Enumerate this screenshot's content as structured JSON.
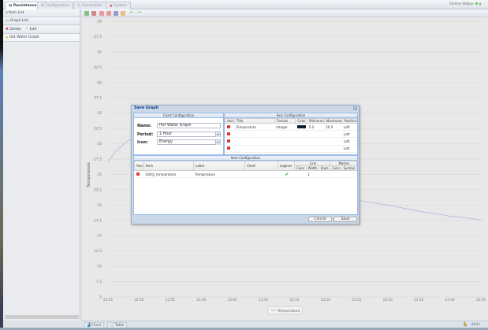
{
  "topbar": {
    "tabs": [
      {
        "label": "Persistence",
        "active": true
      },
      {
        "label": "Configuration"
      },
      {
        "label": "Automation"
      },
      {
        "label": "System"
      }
    ],
    "status_label": "Online Status",
    "status_color": "#44cc44"
  },
  "sidebar": {
    "items": [
      {
        "label": "Item List",
        "icon": "list-icon"
      },
      {
        "label": "Graph List",
        "icon": "graph-icon"
      }
    ],
    "actions": {
      "delete": "Delete",
      "edit": "Edit"
    },
    "graph_item": "Hot Water Graph"
  },
  "toolbar": {
    "icons": [
      "zoom-in-icon",
      "zoom-out-icon",
      "calendar-icon",
      "calendar-icon",
      "calendar-icon",
      "calendar-icon",
      "arrow-left-icon",
      "arrow-right-icon"
    ]
  },
  "chart_data": {
    "type": "line",
    "ylabel": "Temperature",
    "ylim": [
      5,
      50
    ],
    "yticks": [
      "5",
      "7.5",
      "10",
      "12.5",
      "15",
      "17.5",
      "20",
      "22.5",
      "25",
      "27.5",
      "30",
      "32.5",
      "35",
      "37.5",
      "40",
      "42.5",
      "45",
      "47.5",
      "50"
    ],
    "xticks": [
      "22:45",
      "22:50",
      "22:55",
      "23:00",
      "23:05",
      "23:10",
      "23:15",
      "23:20",
      "23:25",
      "23:30",
      "23:35",
      "23:40",
      "23:45"
    ],
    "grid": true,
    "legend": "bottom-center",
    "series": [
      {
        "name": "Temperature",
        "color": "#a9b9d8",
        "points": [
          [
            "22:45",
            27
          ],
          [
            "22:46",
            28.5
          ],
          [
            "22:47",
            29.5
          ],
          [
            "22:48",
            30.3
          ],
          [
            "22:49",
            31
          ],
          [
            "22:50",
            31.6
          ],
          [
            "23:25",
            20.8
          ],
          [
            "23:30",
            20
          ],
          [
            "23:35",
            19
          ],
          [
            "23:40",
            18.2
          ],
          [
            "23:45",
            17.6
          ]
        ]
      }
    ]
  },
  "bottom": {
    "tabs": [
      "Chart",
      "Table"
    ],
    "status_text": "db4o"
  },
  "dialog": {
    "title": "Save Graph",
    "chart_config": {
      "header": "Chart Configuration",
      "name_label": "Name:",
      "name_value": "Hot Water Graph",
      "period_label": "Period:",
      "period_value": "1 Hour",
      "icon_label": "Icon:",
      "icon_value": "Energy"
    },
    "axis_config": {
      "header": "Axis Configuration",
      "columns": [
        "Axis",
        "Title",
        "Format",
        "Color",
        "Minimum",
        "Maximum",
        "Position"
      ],
      "rows": [
        {
          "title": "Temperature",
          "format": "Integer",
          "color": "#0a1f3a",
          "minimum": "5.0",
          "maximum": "50.0",
          "position": "Left"
        },
        {
          "position": "Left"
        },
        {
          "position": "Left"
        },
        {
          "position": "Left"
        }
      ]
    },
    "item_config": {
      "header": "Item Configuration",
      "columns": [
        "Axis",
        "Item",
        "Label",
        "Chart",
        "Legend"
      ],
      "line_header": "Line",
      "marker_header": "Marker",
      "line_cols": [
        "Color",
        "Width",
        "Style"
      ],
      "marker_cols": [
        "Color",
        "Symbol"
      ],
      "rows": [
        {
          "item": "Utility_temperature",
          "label": "Temperature",
          "legend": true,
          "width": "1"
        }
      ]
    },
    "cancel": "Cancel",
    "save": "Save"
  }
}
